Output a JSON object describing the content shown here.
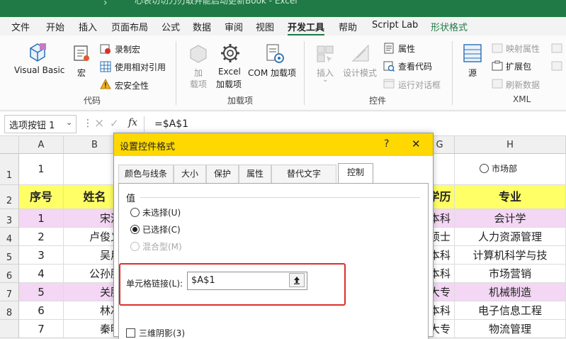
{
  "window": {
    "title": "心表切切刀刃取并能启动更新Book - Excel"
  },
  "menu": {
    "items": [
      "文件",
      "开始",
      "插入",
      "页面布局",
      "公式",
      "数据",
      "审阅",
      "视图",
      "开发工具",
      "帮助",
      "Script Lab",
      "形状格式"
    ],
    "active": "开发工具"
  },
  "ribbon": {
    "code": {
      "label": "代码",
      "visual_basic": "Visual Basic",
      "macros": "宏",
      "record_macro": "录制宏",
      "relative_ref": "使用相对引用",
      "macro_security": "宏安全性"
    },
    "addins": {
      "label": "加载项",
      "addins_line1": "加",
      "addins_line2": "载项",
      "excel_addins_line1": "Excel",
      "excel_addins_line2": "加载项",
      "com_addins": "COM 加载项"
    },
    "controls": {
      "label": "控件",
      "insert": "插入",
      "design_mode": "设计模式",
      "properties": "属性",
      "view_code": "查看代码",
      "run_dialog": "运行对话框"
    },
    "xml": {
      "label": "XML",
      "source": "源",
      "map_properties": "映射属性",
      "expansion_packs": "扩展包",
      "refresh_data": "刷新数据"
    }
  },
  "formula_bar": {
    "name_box": "选项按钮 1",
    "cancel": "×",
    "enter": "✓",
    "fx": "fx",
    "formula": "=$A$1"
  },
  "sheet": {
    "columns": [
      "A",
      "B",
      "G",
      "H"
    ],
    "row_numbers": [
      "1",
      "2",
      "3",
      "4",
      "5",
      "6",
      "7",
      "8"
    ],
    "a1_value": "1",
    "option_button_label": "市场部",
    "header": {
      "seq": "序号",
      "name": "姓名",
      "education": "学历",
      "major": "专业"
    },
    "rows": [
      {
        "seq": "1",
        "name": "宋江",
        "education": "本科",
        "major": "会计学",
        "highlight": true
      },
      {
        "seq": "2",
        "name": "卢俊义",
        "education": "硕士",
        "major": "人力资源管理",
        "highlight": false
      },
      {
        "seq": "3",
        "name": "吴用",
        "education": "本科",
        "major": "计算机科学与技",
        "highlight": false
      },
      {
        "seq": "4",
        "name": "公孙胜",
        "education": "本科",
        "major": "市场营销",
        "highlight": false
      },
      {
        "seq": "5",
        "name": "关胜",
        "education": "大专",
        "major": "机械制造",
        "highlight": true
      },
      {
        "seq": "6",
        "name": "林冲",
        "education": "本科",
        "major": "电子信息工程",
        "highlight": false
      },
      {
        "seq": "7",
        "name": "秦明",
        "education": "大专",
        "major": "物流管理",
        "highlight": false
      }
    ]
  },
  "dialog": {
    "title": "设置控件格式",
    "help": "?",
    "close": "✕",
    "tabs": [
      "颜色与线条",
      "大小",
      "保护",
      "属性",
      "替代文字",
      "控制"
    ],
    "active_tab": "控制",
    "value_section": "值",
    "options": [
      {
        "label": "未选择(U)",
        "state": "unselected"
      },
      {
        "label": "已选择(C)",
        "state": "selected"
      },
      {
        "label": "混合型(M)",
        "state": "disabled"
      }
    ],
    "cell_link_label": "单元格链接(L):",
    "cell_link_value": "$A$1",
    "shading_label": "三维阴影(3)"
  },
  "colors": {
    "excel_green": "#1f7a45",
    "dialog_title": "#ffd800",
    "header_yellow": "#ffff66",
    "row_highlight": "#f4d7f4",
    "callout_red": "#d9312b"
  }
}
